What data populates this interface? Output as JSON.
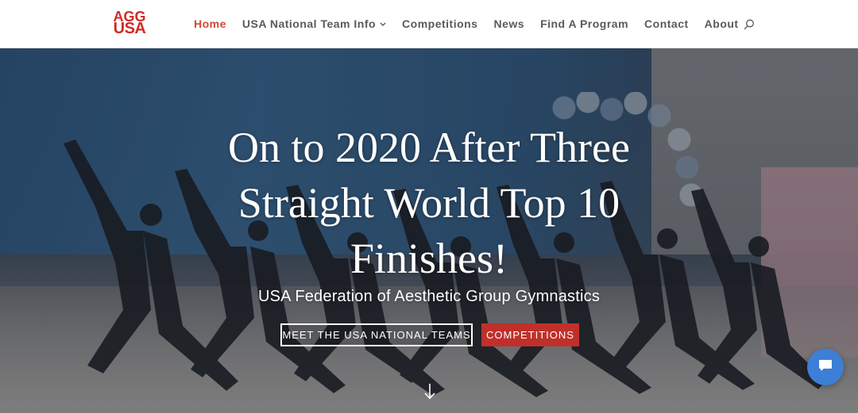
{
  "header": {
    "logo": {
      "line1": "AGG",
      "line2": "USA"
    },
    "nav": {
      "home": "Home",
      "usa_team": "USA National Team Info",
      "competitions": "Competitions",
      "news": "News",
      "find_program": "Find A Program",
      "contact": "Contact",
      "about": "About"
    },
    "search_icon": "search-icon"
  },
  "hero": {
    "title": "On to 2020 After Three Straight World Top 10 Finishes!",
    "subtitle": "USA Federation of Aesthetic Group Gymnastics",
    "buttons": {
      "meet_teams": "MEET THE USA NATIONAL TEAMS",
      "competitions": "COMPETITIONS"
    },
    "scroll_icon": "arrow-down-icon"
  },
  "chat": {
    "icon": "chat-icon"
  },
  "colors": {
    "brand_red": "#d32a24",
    "active_nav": "#d3473a",
    "button_red": "#c0302a",
    "chat_blue": "#3d7fd6",
    "nav_text": "#5a5a5a"
  }
}
